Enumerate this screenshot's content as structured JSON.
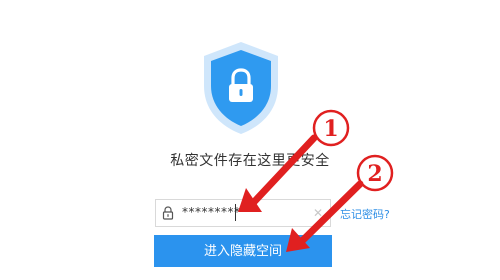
{
  "security": {
    "subtitle": "私密文件存在这里更安全"
  },
  "password": {
    "value": "*********"
  },
  "links": {
    "forgot_password": "忘记密码?"
  },
  "buttons": {
    "enter": "进入隐藏空间"
  },
  "annotations": {
    "marker_1": "1",
    "marker_2": "2"
  },
  "colors": {
    "accent": "#2b93ee",
    "shield_outer": "#cfe6fb",
    "shield_inner": "#2f9af0",
    "annotation": "#e02020"
  },
  "icons": {
    "shield": "shield-lock-icon",
    "lock": "lock-icon",
    "clear": "clear-icon"
  }
}
